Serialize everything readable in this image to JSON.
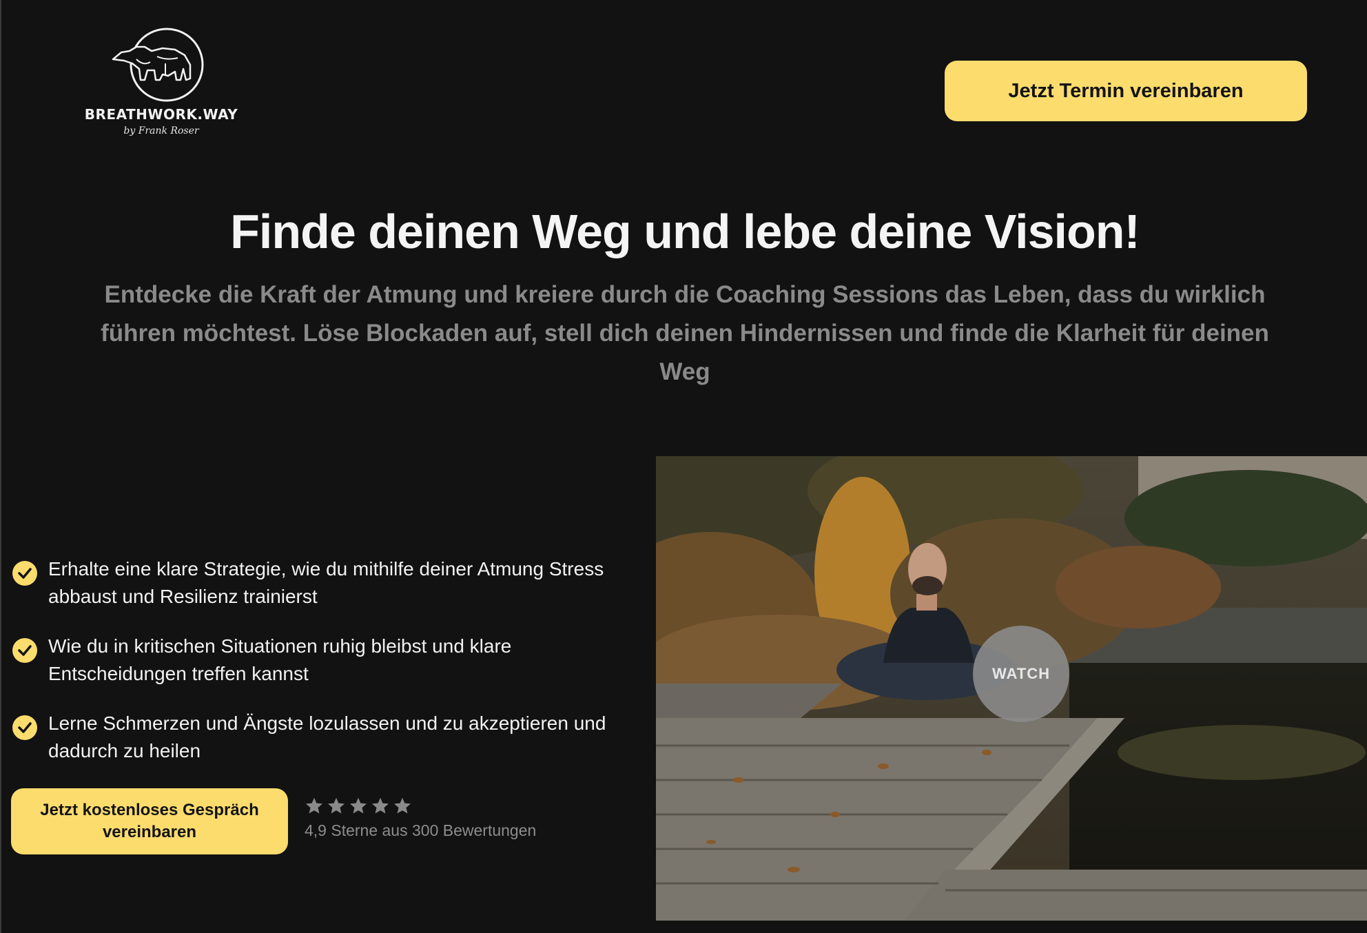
{
  "header": {
    "brand_name": "BREATHWORK.WAY",
    "brand_sub": "by Frank Roser",
    "cta_label": "Jetzt Termin vereinbaren"
  },
  "hero": {
    "title": "Finde deinen Weg und lebe deine Vision!",
    "subtitle": "Entdecke die Kraft der Atmung und kreiere durch die Coaching Sessions das Leben, dass du wirklich führen möchtest. Löse Blockaden auf, stell dich deinen Hindernissen und finde die Klarheit für deinen Weg"
  },
  "benefits": [
    {
      "text": "Erhalte eine klare Strategie, wie du mithilfe deiner Atmung Stress abbaust und Resilienz trainierst"
    },
    {
      "text": "Wie du in kritischen Situationen ruhig bleibst und klare Entscheidungen treffen kannst"
    },
    {
      "text": "Lerne Schmerzen und Ängste lozulassen und zu akzeptieren und dadurch zu heilen"
    }
  ],
  "cta_bottom": {
    "label": "Jetzt kostenloses Gespräch vereinbaren"
  },
  "rating": {
    "stars": 5,
    "text": "4,9 Sterne aus 300 Bewertungen"
  },
  "video": {
    "watch_label": "WATCH"
  },
  "colors": {
    "background": "#121212",
    "accent": "#fcdc6d",
    "muted_text": "#8a8a8a"
  },
  "icons": {
    "benefit": "check-circle-icon",
    "rating": "star-icon",
    "logo": "bear-logo-icon"
  }
}
